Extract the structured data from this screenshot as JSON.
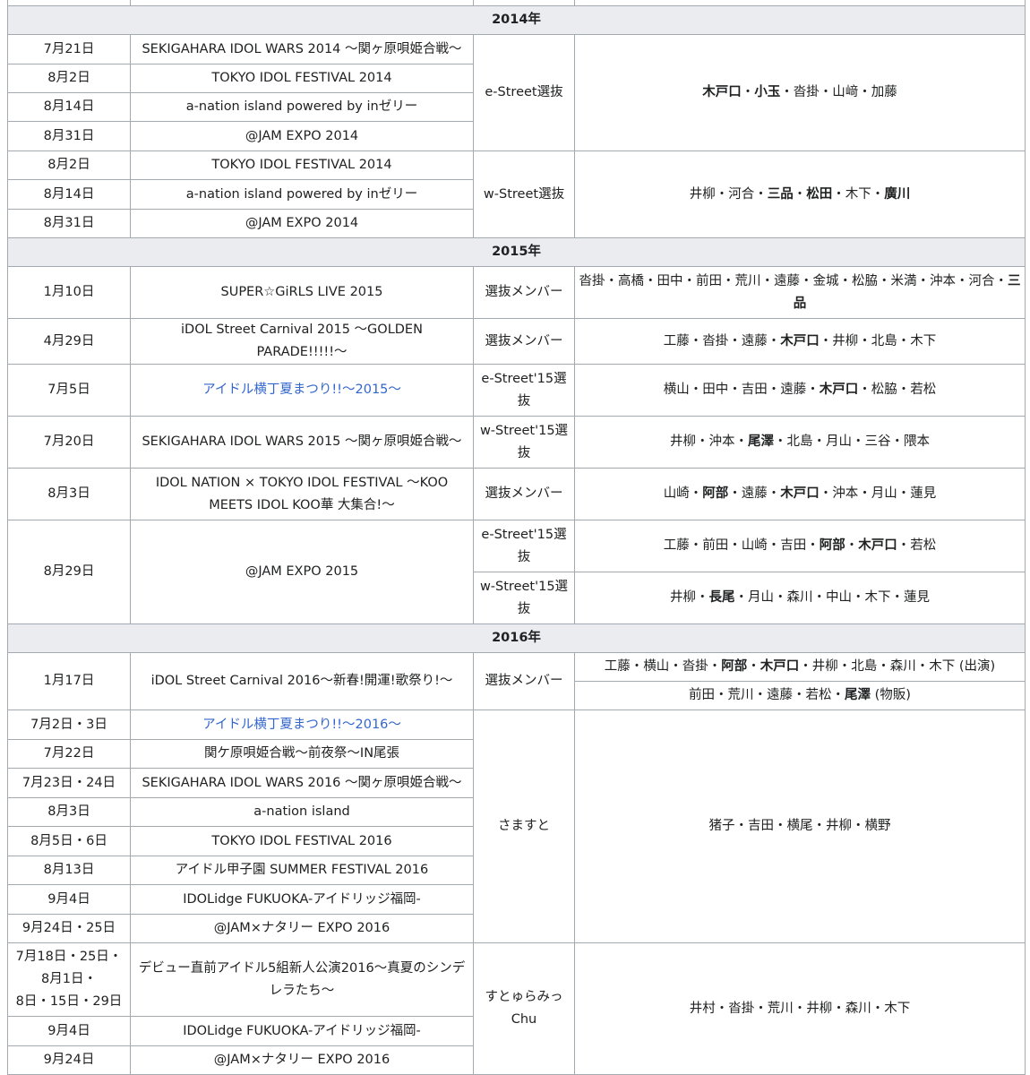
{
  "years": [
    "2014年",
    "2015年",
    "2016年"
  ],
  "rows": [
    {
      "date": "7月21日",
      "event": "SEKIGAHARA IDOL WARS 2014 〜関ヶ原唄姫合戦〜"
    },
    {
      "date": "8月2日",
      "event": "TOKYO IDOL FESTIVAL 2014"
    },
    {
      "date": "8月14日",
      "event": "a-nation island powered by inゼリー"
    },
    {
      "date": "8月31日",
      "event": "@JAM EXPO 2014"
    },
    {
      "date": "8月2日",
      "event": "TOKYO IDOL FESTIVAL 2014"
    },
    {
      "date": "8月14日",
      "event": "a-nation island powered by inゼリー"
    },
    {
      "date": "8月31日",
      "event": "@JAM EXPO 2014"
    },
    {
      "date": "1月10日",
      "event": "SUPER☆GiRLS LIVE 2015"
    },
    {
      "date": "4月29日",
      "event": "iDOL Street Carnival 2015 〜GOLDEN PARADE!!!!!〜"
    },
    {
      "date": "7月5日",
      "event": "アイドル横丁夏まつり!!〜2015〜"
    },
    {
      "date": "7月20日",
      "event": "SEKIGAHARA IDOL WARS 2015 〜関ヶ原唄姫合戦〜"
    },
    {
      "date": "8月3日",
      "event": "IDOL NATION × TOKYO IDOL FESTIVAL 〜KOO MEETS IDOL KOO華 大集合!〜"
    },
    {
      "date": "8月29日",
      "event": "@JAM EXPO 2015"
    },
    {
      "date": "1月17日",
      "event": "iDOL Street Carnival 2016〜新春!開運!歌祭り!〜"
    },
    {
      "date": "7月2日・3日",
      "event": "アイドル横丁夏まつり!!〜2016〜"
    },
    {
      "date": "7月22日",
      "event": "関ケ原唄姫合戦〜前夜祭〜IN尾張"
    },
    {
      "date": "7月23日・24日",
      "event": "SEKIGAHARA IDOL WARS 2016 〜関ヶ原唄姫合戦〜"
    },
    {
      "date": "8月3日",
      "event": "a-nation island"
    },
    {
      "date": "8月5日・6日",
      "event": "TOKYO IDOL FESTIVAL 2016"
    },
    {
      "date": "8月13日",
      "event": "アイドル甲子園 SUMMER FESTIVAL 2016"
    },
    {
      "date": "9月4日",
      "event": "IDOLidge FUKUOKA-アイドリッジ福岡-"
    },
    {
      "date": "9月24日・25日",
      "event": "@JAM×ナタリー EXPO 2016"
    },
    {
      "date": "7月18日・25日・8月1日・8日・15日・29日",
      "event": "デビュー直前アイドル5組新人公演2016〜真夏のシンデレラたち〜"
    },
    {
      "date": "9月4日",
      "event": "IDOLidge FUKUOKA-アイドリッジ福岡-"
    },
    {
      "date": "9月24日",
      "event": "@JAM×ナタリー EXPO 2016"
    }
  ],
  "date_lines": [
    "7月18日・25日・",
    "8月1日・",
    "8日・15日・29日"
  ],
  "units": {
    "e_street": "e-Street選抜",
    "w_street": "w-Street選抜",
    "senbatsu": "選抜メンバー",
    "e_street_15": "e-Street'15選抜",
    "w_street_15": "w-Street'15選抜",
    "samasuto": "さますと",
    "sutoyura": "すとゅらみっChu"
  },
  "members": {
    "r2014e": [
      [
        "木戸口",
        true
      ],
      [
        "小玉",
        true
      ],
      [
        "沓掛",
        false
      ],
      [
        "山﨑",
        false
      ],
      [
        "加藤",
        false
      ]
    ],
    "r2014w": [
      [
        "井柳",
        false
      ],
      [
        "河合",
        false
      ],
      [
        "三品",
        true
      ],
      [
        "松田",
        true
      ],
      [
        "木下",
        false
      ],
      [
        "廣川",
        true
      ]
    ],
    "r0110": [
      [
        "沓掛",
        false
      ],
      [
        "高橋",
        false
      ],
      [
        "田中",
        false
      ],
      [
        "前田",
        false
      ],
      [
        "荒川",
        false
      ],
      [
        "遠藤",
        false
      ],
      [
        "金城",
        false
      ],
      [
        "松脇",
        false
      ],
      [
        "米満",
        false
      ],
      [
        "沖本",
        false
      ],
      [
        "河合",
        false
      ],
      [
        "三品",
        true
      ]
    ],
    "r0429": [
      [
        "工藤",
        false
      ],
      [
        "沓掛",
        false
      ],
      [
        "遠藤",
        false
      ],
      [
        "木戸口",
        true
      ],
      [
        "井柳",
        false
      ],
      [
        "北島",
        false
      ],
      [
        "木下",
        false
      ]
    ],
    "r0705": [
      [
        "横山",
        false
      ],
      [
        "田中",
        false
      ],
      [
        "吉田",
        false
      ],
      [
        "遠藤",
        false
      ],
      [
        "木戸口",
        true
      ],
      [
        "松脇",
        false
      ],
      [
        "若松",
        false
      ]
    ],
    "r0720": [
      [
        "井柳",
        false
      ],
      [
        "沖本",
        false
      ],
      [
        "尾澤",
        true
      ],
      [
        "北島",
        false
      ],
      [
        "月山",
        false
      ],
      [
        "三谷",
        false
      ],
      [
        "隈本",
        false
      ]
    ],
    "r0803": [
      [
        "山崎",
        false
      ],
      [
        "阿部",
        true
      ],
      [
        "遠藤",
        false
      ],
      [
        "木戸口",
        true
      ],
      [
        "沖本",
        false
      ],
      [
        "月山",
        false
      ],
      [
        "蓮見",
        false
      ]
    ],
    "r0829e": [
      [
        "工藤",
        false
      ],
      [
        "前田",
        false
      ],
      [
        "山崎",
        false
      ],
      [
        "吉田",
        false
      ],
      [
        "阿部",
        true
      ],
      [
        "木戸口",
        true
      ],
      [
        "若松",
        false
      ]
    ],
    "r0829w": [
      [
        "井柳",
        false
      ],
      [
        "長尾",
        true
      ],
      [
        "月山",
        false
      ],
      [
        "森川",
        false
      ],
      [
        "中山",
        false
      ],
      [
        "木下",
        false
      ],
      [
        "蓮見",
        false
      ]
    ],
    "r0117a": [
      [
        "工藤",
        false
      ],
      [
        "横山",
        false
      ],
      [
        "沓掛",
        false
      ],
      [
        "阿部",
        true
      ],
      [
        "木戸口",
        true
      ],
      [
        "井柳",
        false
      ],
      [
        "北島",
        false
      ],
      [
        "森川",
        false
      ],
      [
        "木下",
        false
      ]
    ],
    "r0117b": [
      [
        "前田",
        false
      ],
      [
        "荒川",
        false
      ],
      [
        "遠藤",
        false
      ],
      [
        "若松",
        false
      ],
      [
        "尾澤",
        true
      ]
    ],
    "samasuto": [
      [
        "猪子",
        false
      ],
      [
        "吉田",
        false
      ],
      [
        "横尾",
        false
      ],
      [
        "井柳",
        false
      ],
      [
        "横野",
        false
      ]
    ],
    "sutoyura": [
      [
        "井村",
        false
      ],
      [
        "沓掛",
        false
      ],
      [
        "荒川",
        false
      ],
      [
        "井柳",
        false
      ],
      [
        "森川",
        false
      ],
      [
        "木下",
        false
      ]
    ]
  },
  "notes": {
    "shutsuen": " (出演)",
    "buppan": " (物販)"
  },
  "colors": {
    "border": "#a2a9b1",
    "header_bg": "#eaecf0",
    "link": "#3366cc"
  }
}
